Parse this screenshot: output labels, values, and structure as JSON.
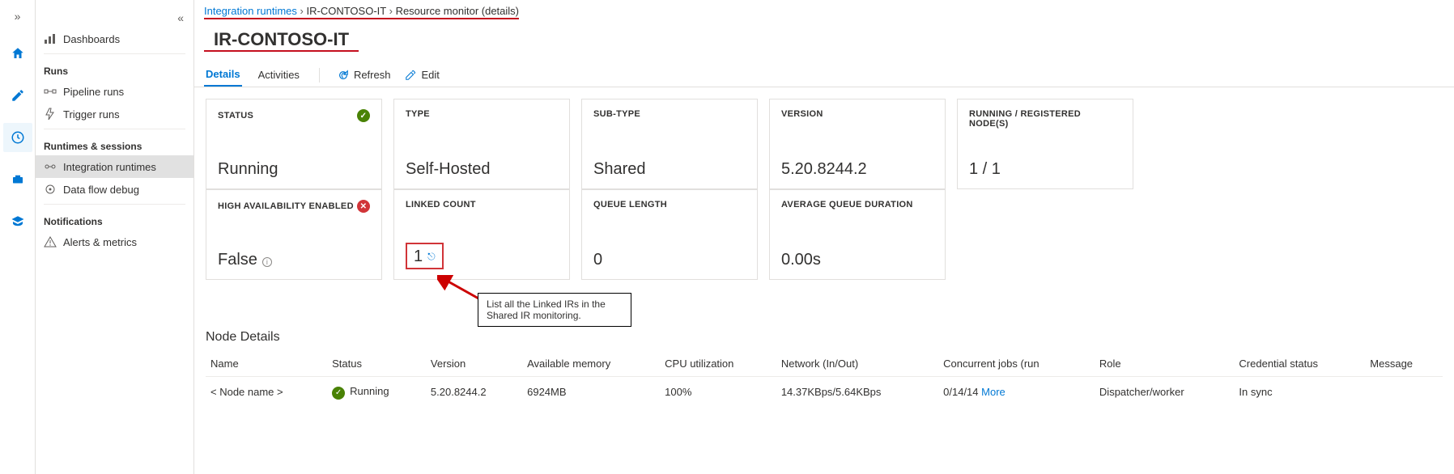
{
  "breadcrumb": {
    "item1": "Integration runtimes",
    "item2": "IR-CONTOSO-IT",
    "item3": "Resource monitor (details)"
  },
  "pageTitle": "IR-CONTOSO-IT",
  "sidebar": {
    "dashboards": "Dashboards",
    "groupRuns": "Runs",
    "pipelineRuns": "Pipeline runs",
    "triggerRuns": "Trigger runs",
    "groupRuntimes": "Runtimes & sessions",
    "integrationRuntimes": "Integration runtimes",
    "dataFlowDebug": "Data flow debug",
    "groupNotifications": "Notifications",
    "alertsMetrics": "Alerts & metrics"
  },
  "tabs": {
    "details": "Details",
    "activities": "Activities",
    "refresh": "Refresh",
    "edit": "Edit"
  },
  "cards": {
    "status": {
      "label": "STATUS",
      "value": "Running"
    },
    "type": {
      "label": "TYPE",
      "value": "Self-Hosted"
    },
    "subtype": {
      "label": "SUB-TYPE",
      "value": "Shared"
    },
    "version": {
      "label": "VERSION",
      "value": "5.20.8244.2"
    },
    "nodes": {
      "label": "RUNNING / REGISTERED NODE(S)",
      "value": "1 / 1"
    },
    "ha": {
      "label": "HIGH AVAILABILITY ENABLED",
      "value": "False"
    },
    "linked": {
      "label": "LINKED COUNT",
      "value": "1"
    },
    "queue": {
      "label": "QUEUE LENGTH",
      "value": "0"
    },
    "avgQueue": {
      "label": "AVERAGE QUEUE DURATION",
      "value": "0.00s"
    }
  },
  "annotation": "List all the Linked IRs in the Shared IR monitoring.",
  "nodeDetails": {
    "title": "Node Details",
    "headers": {
      "name": "Name",
      "status": "Status",
      "version": "Version",
      "memory": "Available memory",
      "cpu": "CPU utilization",
      "network": "Network (In/Out)",
      "concurrent": "Concurrent jobs (run",
      "role": "Role",
      "cred": "Credential status",
      "message": "Message"
    },
    "row": {
      "name": "< Node name >",
      "status": "Running",
      "version": "5.20.8244.2",
      "memory": "6924MB",
      "cpu": "100%",
      "network": "14.37KBps/5.64KBps",
      "concurrent": "0/14/14",
      "more": "More",
      "role": "Dispatcher/worker",
      "cred": "In sync",
      "message": ""
    }
  }
}
